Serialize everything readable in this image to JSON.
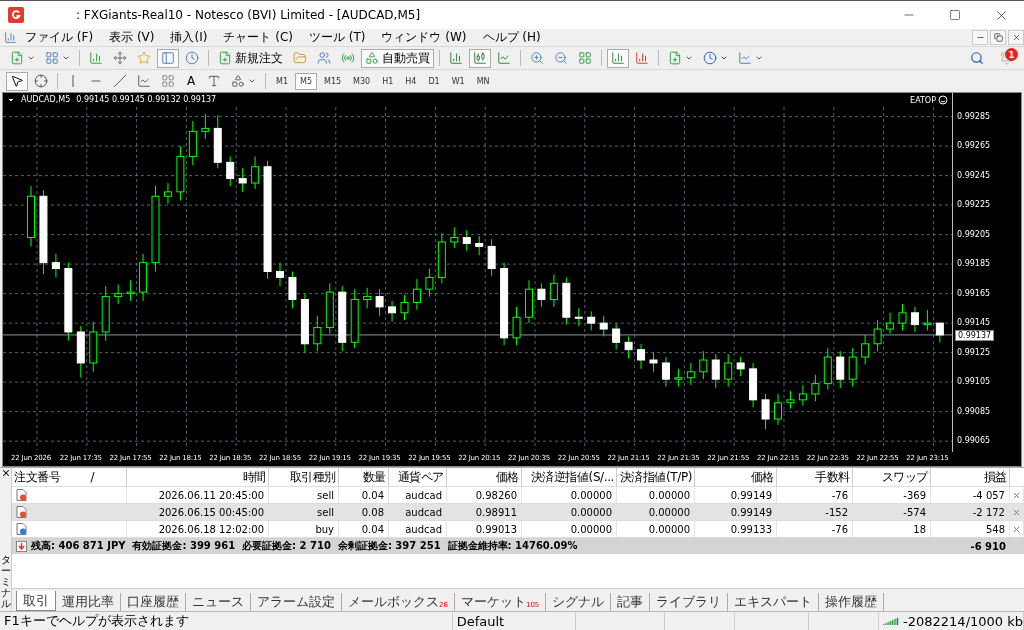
{
  "window": {
    "title": ": FXGiants-Real10 - Notesco (BVI) Limited - [AUDCAD,M5]"
  },
  "menu": [
    "ファイル (F)",
    "表示 (V)",
    "挿入(I)",
    "チャート (C)",
    "ツール (T)",
    "ウィンドウ (W)",
    "ヘルプ (H)"
  ],
  "notifications": {
    "count": "1"
  },
  "toolbar": {
    "new_order": "新規注文",
    "auto_trading": {
      "label": "自動売買",
      "on": true
    }
  },
  "drawing_tools": {
    "text_label": "A"
  },
  "timeframes": [
    {
      "label": "M1",
      "selected": false
    },
    {
      "label": "M5",
      "selected": true
    },
    {
      "label": "M15",
      "selected": false
    },
    {
      "label": "M30",
      "selected": false
    },
    {
      "label": "H1",
      "selected": false
    },
    {
      "label": "H4",
      "selected": false
    },
    {
      "label": "D1",
      "selected": false
    },
    {
      "label": "W1",
      "selected": false
    },
    {
      "label": "MN",
      "selected": false
    }
  ],
  "chart": {
    "symbol": "AUDCAD,M5",
    "quote": "0.99145 0.99145 0.99132 0.99137",
    "expert": "EATOP",
    "current_price": "0.99137",
    "chart_data": {
      "type": "candlestick",
      "categories": [
        "22 Jun 2026",
        null,
        null,
        null,
        "22 Jun 17:35",
        null,
        null,
        null,
        "22 Jun 17:55",
        null,
        null,
        null,
        "22 Jun 18:15",
        null,
        null,
        null,
        "22 Jun 18:35",
        null,
        null,
        null,
        "22 Jun 18:55",
        null,
        null,
        null,
        "22 Jun 19:15",
        null,
        null,
        null,
        "22 Jun 19:35",
        null,
        null,
        null,
        "22 Jun 19:55",
        null,
        null,
        null,
        "22 Jun 20:15",
        null,
        null,
        null,
        "22 Jun 20:35",
        null,
        null,
        null,
        "22 Jun 20:55",
        null,
        null,
        null,
        "22 Jun 21:15",
        null,
        null,
        null,
        "22 Jun 21:35",
        null,
        null,
        null,
        "22 Jun 21:55",
        null,
        null,
        null,
        "22 Jun 22:15",
        null,
        null,
        null,
        "22 Jun 22:35",
        null,
        null,
        null,
        "22 Jun 22:55",
        null,
        null,
        null,
        "22 Jun 23:15",
        null
      ],
      "ylim": [
        0.99059,
        0.99301
      ],
      "ohlc": [
        [
          0.99203,
          0.99238,
          0.99197,
          0.99231
        ],
        [
          0.99231,
          0.99235,
          0.99178,
          0.99186
        ],
        [
          0.99186,
          0.99192,
          0.99176,
          0.99182
        ],
        [
          0.99182,
          0.99186,
          0.99133,
          0.99139
        ],
        [
          0.99139,
          0.99143,
          0.99108,
          0.99118
        ],
        [
          0.99118,
          0.99146,
          0.99112,
          0.99139
        ],
        [
          0.99139,
          0.9917,
          0.99133,
          0.99163
        ],
        [
          0.99163,
          0.99171,
          0.99158,
          0.99165
        ],
        [
          0.99165,
          0.99174,
          0.9916,
          0.99166
        ],
        [
          0.99166,
          0.99192,
          0.9916,
          0.99186
        ],
        [
          0.99186,
          0.99238,
          0.9918,
          0.99231
        ],
        [
          0.99231,
          0.9924,
          0.99226,
          0.99234
        ],
        [
          0.99234,
          0.99265,
          0.99228,
          0.99258
        ],
        [
          0.99258,
          0.99282,
          0.99252,
          0.99275
        ],
        [
          0.99275,
          0.99287,
          0.9927,
          0.99277
        ],
        [
          0.99277,
          0.99286,
          0.9925,
          0.99254
        ],
        [
          0.99254,
          0.99258,
          0.99238,
          0.99243
        ],
        [
          0.99243,
          0.9925,
          0.99234,
          0.9924
        ],
        [
          0.9924,
          0.99258,
          0.99236,
          0.99251
        ],
        [
          0.99251,
          0.99255,
          0.99175,
          0.9918
        ],
        [
          0.9918,
          0.99186,
          0.9917,
          0.99176
        ],
        [
          0.99176,
          0.9918,
          0.99155,
          0.99161
        ],
        [
          0.99161,
          0.99165,
          0.99125,
          0.99131
        ],
        [
          0.99131,
          0.9915,
          0.99126,
          0.99142
        ],
        [
          0.99142,
          0.99172,
          0.99138,
          0.99166
        ],
        [
          0.99166,
          0.9917,
          0.99126,
          0.99132
        ],
        [
          0.99132,
          0.99168,
          0.99128,
          0.99161
        ],
        [
          0.99161,
          0.99169,
          0.99155,
          0.99163
        ],
        [
          0.99163,
          0.99168,
          0.9915,
          0.99156
        ],
        [
          0.99156,
          0.9916,
          0.99146,
          0.99152
        ],
        [
          0.99152,
          0.99164,
          0.99147,
          0.99159
        ],
        [
          0.99159,
          0.99175,
          0.99154,
          0.99168
        ],
        [
          0.99168,
          0.99182,
          0.99163,
          0.99176
        ],
        [
          0.99176,
          0.99206,
          0.99172,
          0.992
        ],
        [
          0.992,
          0.9921,
          0.99196,
          0.99203
        ],
        [
          0.99203,
          0.99208,
          0.99194,
          0.99199
        ],
        [
          0.99199,
          0.99204,
          0.99191,
          0.99197
        ],
        [
          0.99197,
          0.99202,
          0.99177,
          0.99182
        ],
        [
          0.99182,
          0.99186,
          0.9913,
          0.99135
        ],
        [
          0.99135,
          0.99156,
          0.9913,
          0.99149
        ],
        [
          0.99149,
          0.99174,
          0.99145,
          0.99168
        ],
        [
          0.99168,
          0.99172,
          0.99156,
          0.99161
        ],
        [
          0.99161,
          0.99178,
          0.99156,
          0.99172
        ],
        [
          0.99172,
          0.99176,
          0.99144,
          0.99149
        ],
        [
          0.99149,
          0.99155,
          0.99143,
          0.99149
        ],
        [
          0.99149,
          0.99153,
          0.9914,
          0.99145
        ],
        [
          0.99145,
          0.9915,
          0.99136,
          0.99141
        ],
        [
          0.99141,
          0.99145,
          0.99127,
          0.99132
        ],
        [
          0.99132,
          0.99136,
          0.99121,
          0.99127
        ],
        [
          0.99127,
          0.99131,
          0.99114,
          0.9912
        ],
        [
          0.9912,
          0.99125,
          0.99112,
          0.99118
        ],
        [
          0.99118,
          0.99122,
          0.99102,
          0.99107
        ],
        [
          0.99107,
          0.99114,
          0.99102,
          0.99108
        ],
        [
          0.99108,
          0.99118,
          0.99103,
          0.99112
        ],
        [
          0.99112,
          0.99126,
          0.99107,
          0.9912
        ],
        [
          0.9912,
          0.99124,
          0.99101,
          0.99107
        ],
        [
          0.99107,
          0.99124,
          0.99102,
          0.99118
        ],
        [
          0.99118,
          0.99122,
          0.99109,
          0.99114
        ],
        [
          0.99114,
          0.99118,
          0.99088,
          0.99093
        ],
        [
          0.99093,
          0.99097,
          0.99073,
          0.9908
        ],
        [
          0.9908,
          0.99097,
          0.99076,
          0.99091
        ],
        [
          0.99091,
          0.99099,
          0.99087,
          0.99093
        ],
        [
          0.99093,
          0.99103,
          0.99089,
          0.99097
        ],
        [
          0.99097,
          0.9911,
          0.99092,
          0.99104
        ],
        [
          0.99104,
          0.99128,
          0.991,
          0.99122
        ],
        [
          0.99122,
          0.99126,
          0.99101,
          0.99107
        ],
        [
          0.99107,
          0.99128,
          0.99102,
          0.99122
        ],
        [
          0.99122,
          0.99137,
          0.99117,
          0.99131
        ],
        [
          0.99131,
          0.99147,
          0.99126,
          0.99141
        ],
        [
          0.99141,
          0.99152,
          0.99138,
          0.99145
        ],
        [
          0.99145,
          0.99158,
          0.9914,
          0.99152
        ],
        [
          0.99152,
          0.99156,
          0.99139,
          0.99144
        ],
        [
          0.99144,
          0.99154,
          0.9914,
          0.99145
        ],
        [
          0.99145,
          0.99145,
          0.99132,
          0.99137
        ]
      ],
      "yticks": [
        {
          "value": 0.99285,
          "label": "0.99285"
        },
        {
          "value": 0.99265,
          "label": "0.99265"
        },
        {
          "value": 0.99245,
          "label": "0.99245"
        },
        {
          "value": 0.99225,
          "label": "0.99225"
        },
        {
          "value": 0.99205,
          "label": "0.99205"
        },
        {
          "value": 0.99185,
          "label": "0.99185"
        },
        {
          "value": 0.99165,
          "label": "0.99165"
        },
        {
          "value": 0.99145,
          "label": "0.99145"
        },
        {
          "value": 0.99125,
          "label": "0.99125"
        },
        {
          "value": 0.99105,
          "label": "0.99105"
        },
        {
          "value": 0.99085,
          "label": "0.99085"
        },
        {
          "value": 0.99065,
          "label": "0.99065"
        }
      ],
      "grid": true,
      "ref_lines": [
        {
          "axis": "y",
          "value": 0.99137
        }
      ]
    }
  },
  "terminal": {
    "title": "ターミナル",
    "columns": [
      "注文番号",
      "時間",
      "取引種別",
      "数量",
      "通貨ペア",
      "価格",
      "決済逆指値(S/...",
      "決済指値(T/P)",
      "価格",
      "手数料",
      "スワップ",
      "損益"
    ],
    "sort_mark": "/",
    "rows": [
      {
        "kind": "sell",
        "selected": false,
        "cells": [
          "",
          "2026.06.11 20:45:00",
          "sell",
          "0.04",
          "audcad",
          "0.98260",
          "0.00000",
          "0.00000",
          "0.99149",
          "-76",
          "-369",
          "-4 057"
        ]
      },
      {
        "kind": "sell",
        "selected": true,
        "cells": [
          "",
          "2026.06.15 00:45:00",
          "sell",
          "0.08",
          "audcad",
          "0.98911",
          "0.00000",
          "0.00000",
          "0.99149",
          "-152",
          "-574",
          "-2 172"
        ]
      },
      {
        "kind": "buy",
        "selected": false,
        "cells": [
          "",
          "2026.06.18 12:02:00",
          "buy",
          "0.04",
          "audcad",
          "0.99013",
          "0.00000",
          "0.00000",
          "0.99133",
          "-76",
          "18",
          "548"
        ]
      }
    ],
    "summary": "残高: 406 871 JPY  有効証拠金: 399 961  必要証拠金: 2 710  余剰証拠金: 397 251  証拠金維持率: 14760.09%",
    "total": "-6 910",
    "tabs": [
      {
        "label": "取引",
        "selected": true
      },
      {
        "label": "運用比率",
        "selected": false
      },
      {
        "label": "口座履歴",
        "selected": false
      },
      {
        "label": "ニュース",
        "selected": false
      },
      {
        "label": "アラーム設定",
        "selected": false
      },
      {
        "label": "メールボックス",
        "badge": "26",
        "selected": false
      },
      {
        "label": "マーケット",
        "badge": "105",
        "selected": false
      },
      {
        "label": "シグナル",
        "selected": false
      },
      {
        "label": "記事",
        "selected": false
      },
      {
        "label": "ライブラリ",
        "selected": false
      },
      {
        "label": "エキスパート",
        "selected": false
      },
      {
        "label": "操作履歴",
        "selected": false
      }
    ]
  },
  "status_bar": {
    "help": "F1キーでヘルプが表示されます",
    "profile": "Default",
    "traffic": "-2082214/1000 kb"
  }
}
